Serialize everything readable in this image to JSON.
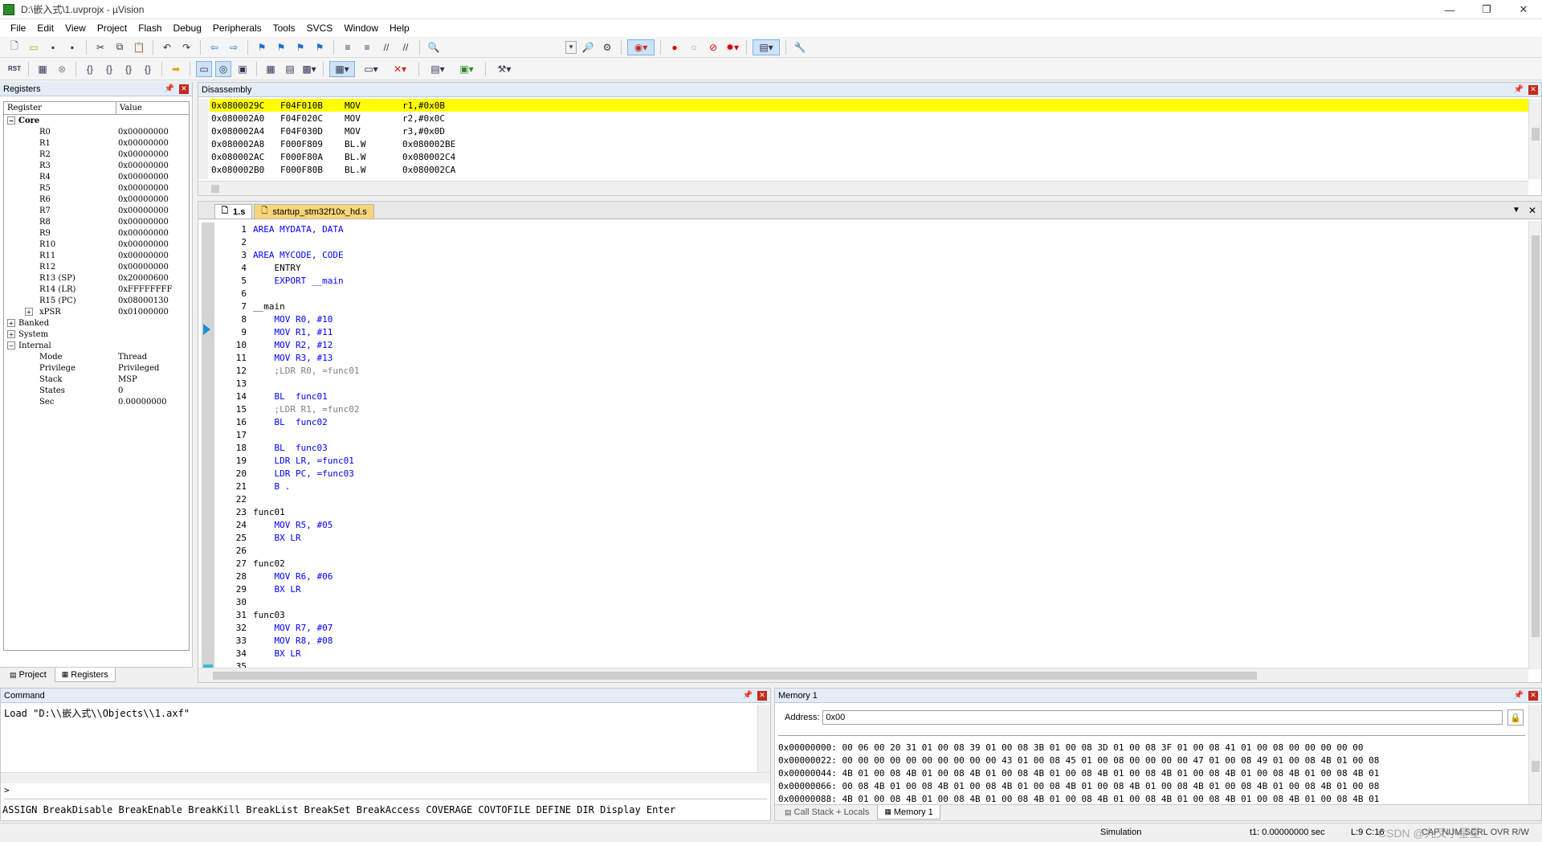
{
  "window": {
    "title": "D:\\嵌入式\\1.uvprojx - µVision",
    "minimize": "—",
    "restore": "❐",
    "close": "✕"
  },
  "menu": [
    "File",
    "Edit",
    "View",
    "Project",
    "Flash",
    "Debug",
    "Peripherals",
    "Tools",
    "SVCS",
    "Window",
    "Help"
  ],
  "toolbar1": {
    "icons": [
      "new-file-icon",
      "open-icon",
      "save-icon",
      "save-all-icon",
      "cut-icon",
      "copy-icon",
      "paste-icon",
      "undo-icon",
      "redo-icon",
      "nav-back-icon",
      "nav-forward-icon",
      "bookmark-icon",
      "bookmark-prev-icon",
      "bookmark-next-icon",
      "bookmark-clear-icon",
      "indent-icon",
      "unindent-icon",
      "comment-icon",
      "uncomment-icon",
      "find-in-files-icon",
      "find-dropdown-icon",
      "incremental-find-icon",
      "debug-session-icon",
      "breakpoint-icon",
      "breakpoint-disable-icon",
      "breakpoint-disable-all-icon",
      "breakpoint-kill-icon",
      "window-layout-icon",
      "configure-icon"
    ]
  },
  "toolbar2": {
    "rst_label": "RST",
    "icons": [
      "reset-icon",
      "run-icon",
      "stop-icon",
      "step-into-icon",
      "step-over-icon",
      "step-out-icon",
      "run-to-cursor-icon",
      "show-next-statement-icon",
      "command-window-icon",
      "disassembly-window-icon",
      "symbols-window-icon",
      "registers-window-icon",
      "call-stack-icon",
      "watch-window-icon",
      "memory-window-icon",
      "serial-window-icon",
      "analysis-window-icon",
      "trace-window-icon",
      "system-viewer-icon",
      "toolbox-icon"
    ]
  },
  "registers": {
    "title": "Registers",
    "col_register": "Register",
    "col_value": "Value",
    "groups": [
      {
        "name": "Core",
        "expander": "−"
      },
      {
        "name": "Banked",
        "expander": "+"
      },
      {
        "name": "System",
        "expander": "+"
      },
      {
        "name": "Internal",
        "expander": "−"
      }
    ],
    "core": [
      {
        "name": "R0",
        "value": "0x00000000"
      },
      {
        "name": "R1",
        "value": "0x00000000"
      },
      {
        "name": "R2",
        "value": "0x00000000"
      },
      {
        "name": "R3",
        "value": "0x00000000"
      },
      {
        "name": "R4",
        "value": "0x00000000"
      },
      {
        "name": "R5",
        "value": "0x00000000"
      },
      {
        "name": "R6",
        "value": "0x00000000"
      },
      {
        "name": "R7",
        "value": "0x00000000"
      },
      {
        "name": "R8",
        "value": "0x00000000"
      },
      {
        "name": "R9",
        "value": "0x00000000"
      },
      {
        "name": "R10",
        "value": "0x00000000"
      },
      {
        "name": "R11",
        "value": "0x00000000"
      },
      {
        "name": "R12",
        "value": "0x00000000"
      },
      {
        "name": "R13 (SP)",
        "value": "0x20000600"
      },
      {
        "name": "R14 (LR)",
        "value": "0xFFFFFFFF"
      },
      {
        "name": "R15 (PC)",
        "value": "0x08000130"
      },
      {
        "name": "xPSR",
        "value": "0x01000000",
        "expander": "+"
      }
    ],
    "internal": [
      {
        "name": "Mode",
        "value": "Thread"
      },
      {
        "name": "Privilege",
        "value": "Privileged"
      },
      {
        "name": "Stack",
        "value": "MSP"
      },
      {
        "name": "States",
        "value": "0"
      },
      {
        "name": "Sec",
        "value": "0.00000000"
      }
    ],
    "tabs": [
      "Project",
      "Registers"
    ]
  },
  "disassembly": {
    "title": "Disassembly",
    "lines": [
      {
        "addr": "0x0800029C",
        "code": "F04F010B",
        "mnem": "MOV",
        "ops": "r1,#0x0B"
      },
      {
        "addr": "0x080002A0",
        "code": "F04F020C",
        "mnem": "MOV",
        "ops": "r2,#0x0C"
      },
      {
        "addr": "0x080002A4",
        "code": "F04F030D",
        "mnem": "MOV",
        "ops": "r3,#0x0D"
      },
      {
        "addr": "0x080002A8",
        "code": "F000F809",
        "mnem": "BL.W",
        "ops": "0x080002BE"
      },
      {
        "addr": "0x080002AC",
        "code": "F000F80A",
        "mnem": "BL.W",
        "ops": "0x080002C4"
      },
      {
        "addr": "0x080002B0",
        "code": "F000F80B",
        "mnem": "BL.W",
        "ops": "0x080002CA"
      }
    ]
  },
  "editor": {
    "tabs": [
      "1.s",
      "startup_stm32f10x_hd.s"
    ],
    "lines": [
      {
        "n": "1",
        "t": "AREA MYDATA, DATA"
      },
      {
        "n": "2",
        "t": ""
      },
      {
        "n": "3",
        "t": "AREA MYCODE, CODE"
      },
      {
        "n": "4",
        "t": "    ENTRY"
      },
      {
        "n": "5",
        "t": "    EXPORT __main"
      },
      {
        "n": "6",
        "t": ""
      },
      {
        "n": "7",
        "t": "__main"
      },
      {
        "n": "8",
        "t": "    MOV R0, #10"
      },
      {
        "n": "9",
        "t": "    MOV R1, #11"
      },
      {
        "n": "10",
        "t": "    MOV R2, #12"
      },
      {
        "n": "11",
        "t": "    MOV R3, #13"
      },
      {
        "n": "12",
        "t": "    ;LDR R0, =func01"
      },
      {
        "n": "13",
        "t": ""
      },
      {
        "n": "14",
        "t": "    BL  func01"
      },
      {
        "n": "15",
        "t": "    ;LDR R1, =func02"
      },
      {
        "n": "16",
        "t": "    BL  func02"
      },
      {
        "n": "17",
        "t": ""
      },
      {
        "n": "18",
        "t": "    BL  func03"
      },
      {
        "n": "19",
        "t": "    LDR LR, =func01"
      },
      {
        "n": "20",
        "t": "    LDR PC, =func03"
      },
      {
        "n": "21",
        "t": "    B ."
      },
      {
        "n": "22",
        "t": ""
      },
      {
        "n": "23",
        "t": "func01"
      },
      {
        "n": "24",
        "t": "    MOV R5, #05"
      },
      {
        "n": "25",
        "t": "    BX LR"
      },
      {
        "n": "26",
        "t": ""
      },
      {
        "n": "27",
        "t": "func02"
      },
      {
        "n": "28",
        "t": "    MOV R6, #06"
      },
      {
        "n": "29",
        "t": "    BX LR"
      },
      {
        "n": "30",
        "t": ""
      },
      {
        "n": "31",
        "t": "func03"
      },
      {
        "n": "32",
        "t": "    MOV R7, #07"
      },
      {
        "n": "33",
        "t": "    MOV R8, #08"
      },
      {
        "n": "34",
        "t": "    BX LR"
      },
      {
        "n": "35",
        "t": ""
      }
    ]
  },
  "command": {
    "title": "Command",
    "output": "Load \"D:\\\\嵌入式\\\\Objects\\\\1.axf\"",
    "prompt": ">",
    "hints": "ASSIGN BreakDisable BreakEnable BreakKill BreakList BreakSet BreakAccess COVERAGE COVTOFILE DEFINE DIR Display Enter"
  },
  "memory": {
    "title": "Memory 1",
    "address_label": "Address:",
    "address_value": "0x00",
    "lines": [
      "0x00000000: 00 06 00 20 31 01 00 08 39 01 00 08 3B 01 00 08 3D 01 00 08 3F 01 00 08 41 01 00 08 00 00 00 00 00",
      "0x00000022: 00 00 00 00 00 00 00 00 00 00 43 01 00 08 45 01 00 08 00 00 00 00 47 01 00 08 49 01 00 08 4B 01 00 08",
      "0x00000044: 4B 01 00 08 4B 01 00 08 4B 01 00 08 4B 01 00 08 4B 01 00 08 4B 01 00 08 4B 01 00 08 4B 01 00 08 4B 01",
      "0x00000066: 00 08 4B 01 00 08 4B 01 00 08 4B 01 00 08 4B 01 00 08 4B 01 00 08 4B 01 00 08 4B 01 00 08 4B 01 00 08",
      "0x00000088: 4B 01 00 08 4B 01 00 08 4B 01 00 08 4B 01 00 08 4B 01 00 08 4B 01 00 08 4B 01 00 08 4B 01 00 08 4B 01"
    ],
    "tabs": [
      "Call Stack + Locals",
      "Memory 1"
    ]
  },
  "statusbar": {
    "mode": "Simulation",
    "time": "t1: 0.00000000 sec",
    "position": "L:9 C:16",
    "caps": "CAP NUM SCRL OVR R/W",
    "watermark": "CSDN @九叉小星星"
  },
  "colors": {
    "highlight": "#ffff00",
    "accent": "#1e6fd0",
    "keyword": "#0000ff",
    "number": "#c00000"
  }
}
